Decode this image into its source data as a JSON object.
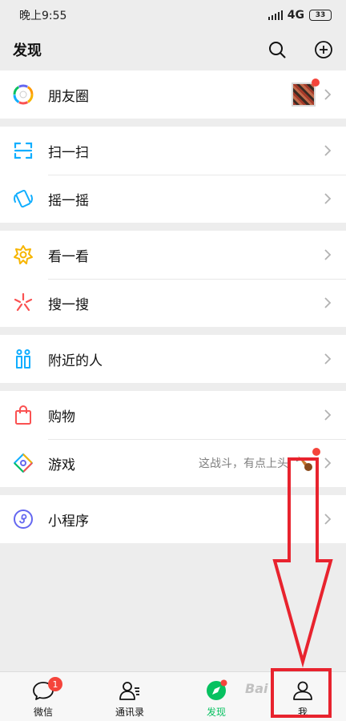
{
  "status": {
    "time": "晚上9:55",
    "network": "4G",
    "battery": "33"
  },
  "header": {
    "title": "发现",
    "search_icon": "search-icon",
    "add_icon": "plus-circle-icon"
  },
  "groups": [
    {
      "items": [
        {
          "label": "朋友圈",
          "icon": "moments-aperture-icon",
          "has_thumb": true,
          "dot": true
        }
      ]
    },
    {
      "items": [
        {
          "label": "扫一扫",
          "icon": "scan-icon"
        },
        {
          "label": "摇一摇",
          "icon": "shake-phone-icon"
        }
      ]
    },
    {
      "items": [
        {
          "label": "看一看",
          "icon": "top-stories-icon"
        },
        {
          "label": "搜一搜",
          "icon": "search-sparkle-icon"
        }
      ]
    },
    {
      "items": [
        {
          "label": "附近的人",
          "icon": "people-nearby-icon"
        }
      ]
    },
    {
      "items": [
        {
          "label": "购物",
          "icon": "shopping-bag-icon"
        },
        {
          "label": "游戏",
          "icon": "games-diamond-icon",
          "subtext": "这战斗，有点上头",
          "dot": true
        }
      ]
    },
    {
      "items": [
        {
          "label": "小程序",
          "icon": "mini-program-icon"
        }
      ]
    }
  ],
  "tabs": [
    {
      "label": "微信",
      "icon": "chat-bubble-icon",
      "badge": "1"
    },
    {
      "label": "通讯录",
      "icon": "contacts-icon"
    },
    {
      "label": "发现",
      "icon": "discover-compass-icon",
      "active": true
    },
    {
      "label": "我",
      "icon": "me-person-icon"
    }
  ],
  "colors": {
    "accent": "#07c160",
    "badge": "#f5443b",
    "annotation": "#e8232e",
    "background": "#ededed"
  },
  "watermark": "Bai"
}
